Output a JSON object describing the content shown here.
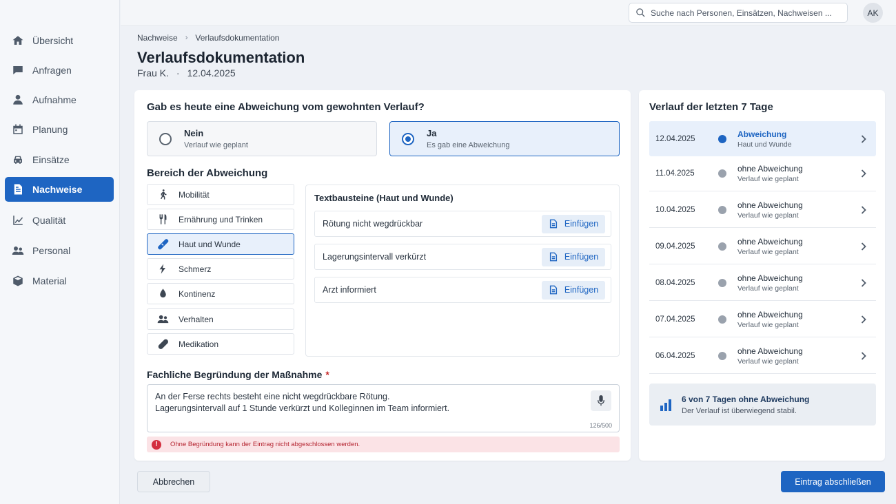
{
  "sidebar": {
    "items": [
      {
        "label": "Übersicht",
        "icon": "home-icon"
      },
      {
        "label": "Anfragen",
        "icon": "chat-icon"
      },
      {
        "label": "Aufnahme",
        "icon": "person-icon"
      },
      {
        "label": "Planung",
        "icon": "calendar-icon"
      },
      {
        "label": "Einsätze",
        "icon": "car-icon"
      },
      {
        "label": "Nachweise",
        "icon": "document-icon",
        "active": true
      },
      {
        "label": "Qualität",
        "icon": "trend-icon"
      },
      {
        "label": "Personal",
        "icon": "people-icon"
      },
      {
        "label": "Material",
        "icon": "box-icon"
      }
    ]
  },
  "topbar": {
    "search_placeholder": "Suche nach Personen, Einsätzen, Nachweisen ...",
    "avatar_initials": "AK"
  },
  "header": {
    "breadcrumb": [
      "Nachweise",
      "Verlaufsdokumentation"
    ],
    "title": "Verlaufsdokumentation",
    "client": "Frau K.",
    "separator": "·",
    "date": "12.04.2025"
  },
  "question": {
    "title": "Gab es heute eine Abweichung vom gewohnten Verlauf?",
    "options": [
      {
        "label": "Nein",
        "sub": "Verlauf wie geplant",
        "selected": false
      },
      {
        "label": "Ja",
        "sub": "Es gab eine Abweichung",
        "selected": true
      }
    ]
  },
  "area": {
    "title": "Bereich der Abweichung",
    "categories": [
      {
        "label": "Mobilität",
        "icon": "walk-icon"
      },
      {
        "label": "Ernährung und Trinken",
        "icon": "cutlery-icon"
      },
      {
        "label": "Haut und Wunde",
        "icon": "bandage-icon",
        "active": true
      },
      {
        "label": "Schmerz",
        "icon": "lightning-icon"
      },
      {
        "label": "Kontinenz",
        "icon": "drop-icon"
      },
      {
        "label": "Verhalten",
        "icon": "people-icon"
      },
      {
        "label": "Medikation",
        "icon": "pill-icon"
      }
    ]
  },
  "snippets": {
    "title": "Textbausteine (Haut und Wunde)",
    "insert_label": "Einfügen",
    "items": [
      "Rötung nicht wegdrückbar",
      "Lagerungsintervall verkürzt",
      "Arzt informiert"
    ]
  },
  "reason": {
    "label": "Fachliche Begründung der Maßnahme",
    "required_mark": "*",
    "text": "An der Ferse rechts besteht eine nicht wegdrückbare Rötung.\nLagerungsintervall auf 1 Stunde verkürzt und Kolleginnen im Team informiert.",
    "counter": "126/500",
    "error": "Ohne Begründung kann der Eintrag nicht abgeschlossen werden.",
    "error_icon": "!"
  },
  "history": {
    "title": "Verlauf der letzten 7 Tage",
    "rows": [
      {
        "date": "12.04.2025",
        "status": "Abweichung",
        "sub": "Haut und Wunde",
        "active": true
      },
      {
        "date": "11.04.2025",
        "status": "ohne Abweichung",
        "sub": "Verlauf wie geplant"
      },
      {
        "date": "10.04.2025",
        "status": "ohne Abweichung",
        "sub": "Verlauf wie geplant"
      },
      {
        "date": "09.04.2025",
        "status": "ohne Abweichung",
        "sub": "Verlauf wie geplant"
      },
      {
        "date": "08.04.2025",
        "status": "ohne Abweichung",
        "sub": "Verlauf wie geplant"
      },
      {
        "date": "07.04.2025",
        "status": "ohne Abweichung",
        "sub": "Verlauf wie geplant"
      },
      {
        "date": "06.04.2025",
        "status": "ohne Abweichung",
        "sub": "Verlauf wie geplant"
      }
    ],
    "summary_title": "6 von 7 Tagen ohne Abweichung",
    "summary_sub": "Der Verlauf ist überwiegend stabil."
  },
  "footer": {
    "cancel_label": "Abbrechen",
    "submit_label": "Eintrag abschließen"
  },
  "colors": {
    "accent": "#1e65c2",
    "error": "#d32f3f",
    "error_bg": "#fbe3e6"
  }
}
